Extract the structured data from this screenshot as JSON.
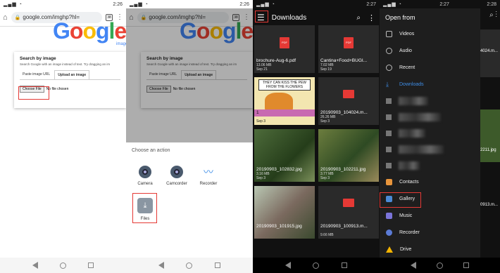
{
  "panel1": {
    "status_time": "2:26",
    "url": "google.com/imghp?hl=",
    "tab_count": "38",
    "logo_letters": [
      "G",
      "o",
      "o",
      "g",
      "l",
      "e"
    ],
    "logo_sub": "images",
    "card_title": "Search by image",
    "card_desc": "Search Google with an image instead of text. Try dragging an im",
    "tab_paste": "Paste image URL",
    "tab_upload": "Upload an image",
    "choose_file": "Choose File",
    "no_file": "No file chosen"
  },
  "panel2": {
    "status_time": "2:26",
    "url": "google.com/imghp?hl=",
    "tab_count": "38",
    "sheet_title": "Choose an action",
    "apps": [
      {
        "label": "Camera",
        "icon": "camera-icon"
      },
      {
        "label": "Camcorder",
        "icon": "camcorder-icon"
      },
      {
        "label": "Recorder",
        "icon": "recorder-icon"
      }
    ],
    "files_label": "Files"
  },
  "panel3": {
    "status_time": "2:27",
    "title": "Downloads",
    "tiles": [
      {
        "name": "brochure-Aug-6.pdf",
        "size": "13.06 MB",
        "date": "Sep 21",
        "kind": "pdf"
      },
      {
        "name": "Cantina+Food+BUGI...",
        "size": "7.02 MB",
        "date": "Sep 19",
        "kind": "pdf"
      },
      {
        "name": "1",
        "size": "",
        "date": "Sep 3",
        "kind": "comic",
        "comic_text": "THEY CAN KISS THE PEW FROM THE FLOWERS"
      },
      {
        "name": "20190903_104024.m...",
        "size": "26.26 MB",
        "date": "Sep 3",
        "kind": "video"
      },
      {
        "name": "20190903_102832.jpg",
        "size": "3.16 MB",
        "date": "Sep 3",
        "kind": "photo"
      },
      {
        "name": "20190903_102211.jpg",
        "size": "3.77 MB",
        "date": "Sep 3",
        "kind": "photo"
      },
      {
        "name": "20190903_101915.jpg",
        "size": "",
        "date": "",
        "kind": "photo"
      },
      {
        "name": "20190903_100913.m...",
        "size": "9.66 MB",
        "date": "",
        "kind": "video"
      }
    ]
  },
  "panel4": {
    "status_time": "2:27",
    "status_time_right": "2:28",
    "drawer_title": "Open from",
    "items_top": [
      {
        "label": "Videos",
        "icon": "video-icon"
      },
      {
        "label": "Audio",
        "icon": "audio-icon"
      },
      {
        "label": "Recent",
        "icon": "clock-icon"
      },
      {
        "label": "Downloads",
        "icon": "download-icon",
        "selected": true
      }
    ],
    "items_bottom": [
      {
        "label": "Contacts",
        "icon": "contacts-icon"
      },
      {
        "label": "Gallery",
        "icon": "gallery-icon"
      },
      {
        "label": "Music",
        "icon": "music-icon"
      },
      {
        "label": "Recorder",
        "icon": "recorder-icon"
      },
      {
        "label": "Drive",
        "icon": "drive-icon"
      }
    ],
    "bg_labels": [
      "4024.m...",
      "2211.jpg",
      "0913.m..."
    ]
  }
}
